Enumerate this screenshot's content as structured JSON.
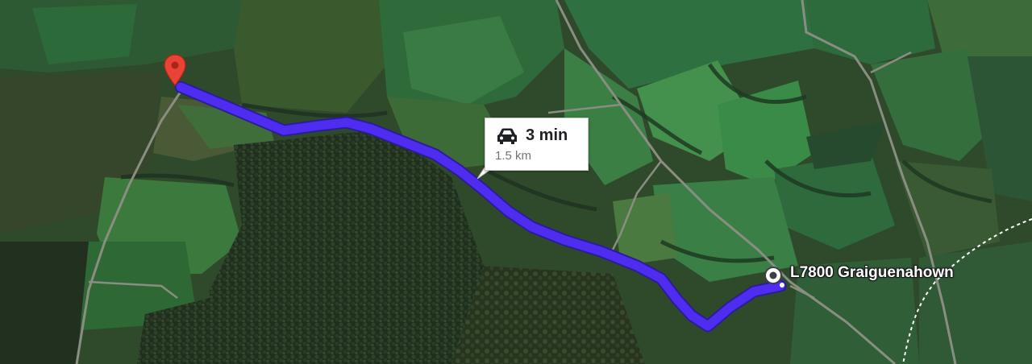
{
  "map": {
    "type": "satellite",
    "route_color": "#4f2df0",
    "pin_color": "#ea4335"
  },
  "route_info": {
    "icon": "car-icon",
    "duration": "3 min",
    "distance": "1.5 km"
  },
  "destination": {
    "icon": "place-marker-icon",
    "label": "L7800 Graiguenahown"
  },
  "origin": {
    "icon": "red-pin-icon"
  }
}
